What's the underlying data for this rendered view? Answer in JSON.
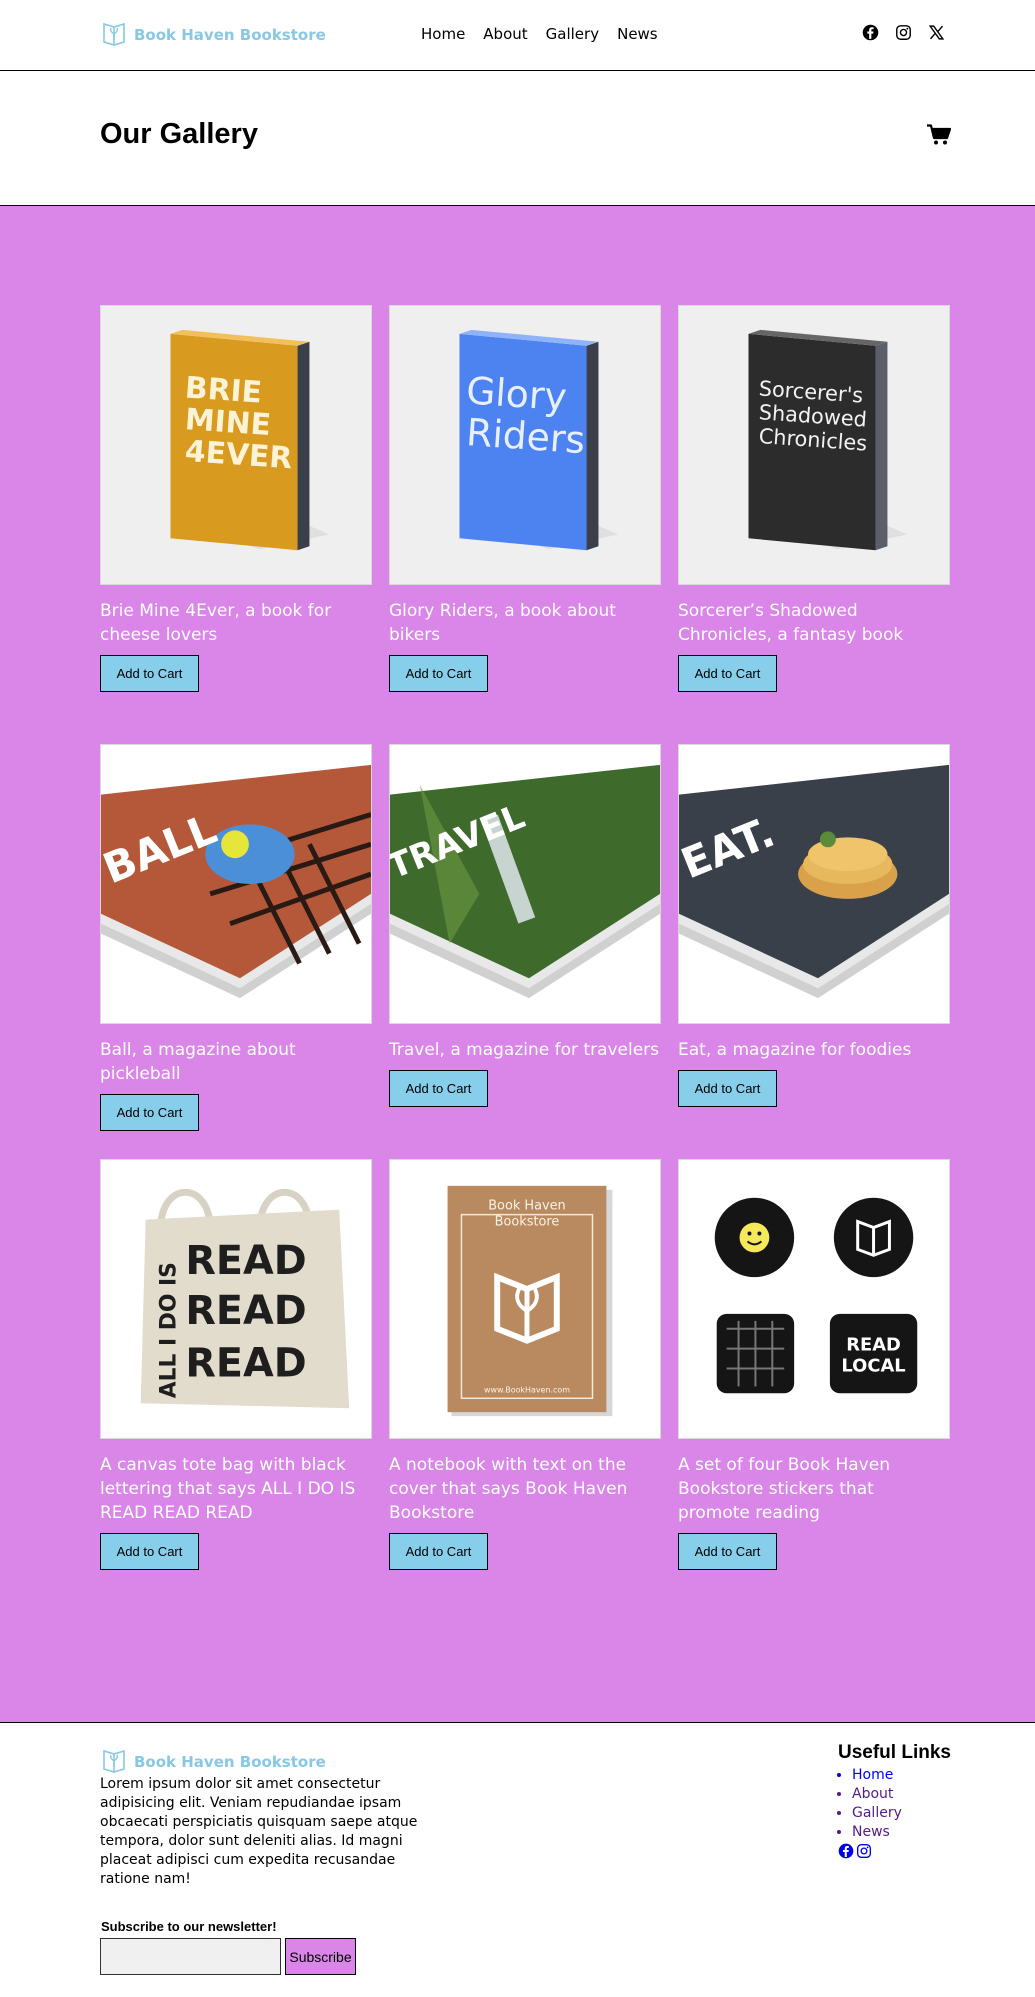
{
  "brand": {
    "name": "Book Haven Bookstore",
    "color": "#87c8e6"
  },
  "nav": {
    "items": [
      "Home",
      "About",
      "Gallery",
      "News"
    ]
  },
  "social": {
    "icons": [
      "facebook-icon",
      "instagram-icon",
      "x-icon"
    ]
  },
  "page": {
    "title": "Our Gallery"
  },
  "gallery": {
    "background": "#d986e8",
    "button_label": "Add to Cart",
    "items": [
      {
        "caption": "Brie Mine 4Ever, a book for cheese lovers",
        "art_lines": [
          "BRIE",
          "MINE",
          "4EVER"
        ]
      },
      {
        "caption": "Glory Riders, a book about bikers",
        "art_lines": [
          "Glory",
          "Riders"
        ]
      },
      {
        "caption": "Sorcerer’s Shadowed Chronicles, a fantasy book",
        "art_lines": [
          "Sorcerer's",
          "Shadowed",
          "Chronicles"
        ]
      },
      {
        "caption": "Ball, a magazine about pickleball",
        "art_lines": [
          "BALL"
        ]
      },
      {
        "caption": "Travel, a magazine for travelers",
        "art_lines": [
          "TRAVEL"
        ]
      },
      {
        "caption": "Eat, a magazine for foodies",
        "art_lines": [
          "EAT."
        ]
      },
      {
        "caption": "A canvas tote bag with black lettering that says ALL I DO IS READ READ READ",
        "art_lines": [
          "READ",
          "READ",
          "READ",
          "ALL I DO IS"
        ]
      },
      {
        "caption": "A notebook with text on the cover that says Book Haven Bookstore",
        "art_lines": [
          "Book Haven",
          "Bookstore",
          "www.BookHaven.com"
        ]
      },
      {
        "caption": "A set of four Book Haven Bookstore stickers that promote reading",
        "art_lines": [
          "READ",
          "LOCAL"
        ]
      }
    ]
  },
  "footer": {
    "brand": "Book Haven Bookstore",
    "about": "Lorem ipsum dolor sit amet consectetur adipisicing elit. Veniam repudiandae ipsam obcaecati perspiciatis quisquam saepe atque tempora, dolor sunt deleniti alias. Id magni placeat adipisci cum expedita recusandae ratione nam!",
    "links_title": "Useful Links",
    "links": [
      "Home",
      "About",
      "Gallery",
      "News"
    ],
    "newsletter_label": "Subscribe to our newsletter!",
    "subscribe_label": "Subscribe"
  }
}
